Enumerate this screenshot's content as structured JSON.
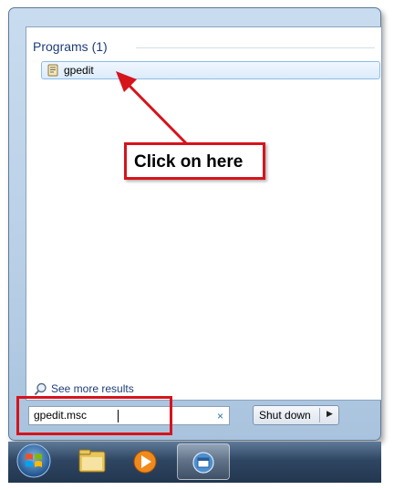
{
  "start_menu": {
    "programs_header": "Programs (1)",
    "results": [
      {
        "label": "gpedit",
        "icon": "group-policy-icon"
      }
    ],
    "see_more": "See more results"
  },
  "search": {
    "value": "gpedit.msc",
    "clear_icon": "×"
  },
  "shutdown": {
    "label": "Shut down",
    "arrow": "▶"
  },
  "annotation": {
    "callout": "Click on here",
    "color": "#d6141b"
  },
  "taskbar": {
    "items": [
      "windows-start-orb",
      "windows-explorer-icon",
      "media-player-icon",
      "active-window-icon"
    ]
  }
}
